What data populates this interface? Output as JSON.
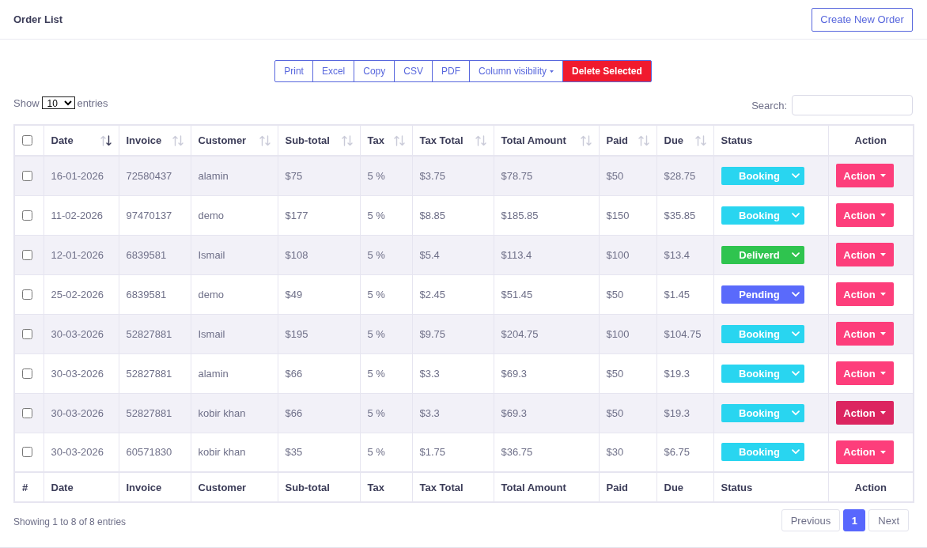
{
  "header": {
    "title": "Order List",
    "create_button": "Create New Order"
  },
  "toolbar": [
    {
      "label": "Print",
      "kind": "plain"
    },
    {
      "label": "Excel",
      "kind": "plain"
    },
    {
      "label": "Copy",
      "kind": "plain"
    },
    {
      "label": "CSV",
      "kind": "plain"
    },
    {
      "label": "PDF",
      "kind": "plain"
    },
    {
      "label": "Column visibility",
      "kind": "dropdown"
    },
    {
      "label": "Delete Selected",
      "kind": "danger"
    }
  ],
  "length_menu": {
    "label_before": "Show",
    "value": "10",
    "label_after": "entries"
  },
  "search": {
    "label": "Search:"
  },
  "table": {
    "select_all_checked": false,
    "columns": [
      {
        "label": "Date",
        "sortable": true,
        "sorted": true
      },
      {
        "label": "Invoice",
        "sortable": true,
        "sorted": false
      },
      {
        "label": "Customer",
        "sortable": true,
        "sorted": false
      },
      {
        "label": "Sub-total",
        "sortable": true,
        "sorted": false
      },
      {
        "label": "Tax",
        "sortable": true,
        "sorted": false
      },
      {
        "label": "Tax Total",
        "sortable": true,
        "sorted": false
      },
      {
        "label": "Total Amount",
        "sortable": true,
        "sorted": false
      },
      {
        "label": "Paid",
        "sortable": true,
        "sorted": false
      },
      {
        "label": "Due",
        "sortable": true,
        "sorted": false
      },
      {
        "label": "Status",
        "sortable": false
      },
      {
        "label": "Action",
        "sortable": false
      }
    ],
    "rows": [
      {
        "checked": false,
        "cells": [
          "16-01-2026",
          "72580437",
          "alamin",
          "$75",
          "5 %",
          "$3.75",
          "$78.75",
          "$50",
          "$28.75"
        ],
        "status": {
          "label": "Booking",
          "color": "#29d5f0"
        },
        "action": {
          "label": "Action",
          "hovered": false
        }
      },
      {
        "checked": false,
        "cells": [
          "11-02-2026",
          "97470137",
          "demo",
          "$177",
          "5 %",
          "$8.85",
          "$185.85",
          "$150",
          "$35.85"
        ],
        "status": {
          "label": "Booking",
          "color": "#29d5f0"
        },
        "action": {
          "label": "Action",
          "hovered": false
        }
      },
      {
        "checked": false,
        "cells": [
          "12-01-2026",
          "6839581",
          "Ismail",
          "$108",
          "5 %",
          "$5.4",
          "$113.4",
          "$100",
          "$13.4"
        ],
        "status": {
          "label": "Deliverd",
          "color": "#2fc44f"
        },
        "action": {
          "label": "Action",
          "hovered": false
        }
      },
      {
        "checked": false,
        "cells": [
          "25-02-2026",
          "6839581",
          "demo",
          "$49",
          "5 %",
          "$2.45",
          "$51.45",
          "$50",
          "$1.45"
        ],
        "status": {
          "label": "Pending",
          "color": "#5a6afb"
        },
        "action": {
          "label": "Action",
          "hovered": false
        }
      },
      {
        "checked": false,
        "cells": [
          "30-03-2026",
          "52827881",
          "Ismail",
          "$195",
          "5 %",
          "$9.75",
          "$204.75",
          "$100",
          "$104.75"
        ],
        "status": {
          "label": "Booking",
          "color": "#29d5f0"
        },
        "action": {
          "label": "Action",
          "hovered": false
        }
      },
      {
        "checked": false,
        "cells": [
          "30-03-2026",
          "52827881",
          "alamin",
          "$66",
          "5 %",
          "$3.3",
          "$69.3",
          "$50",
          "$19.3"
        ],
        "status": {
          "label": "Booking",
          "color": "#29d5f0"
        },
        "action": {
          "label": "Action",
          "hovered": false
        }
      },
      {
        "checked": false,
        "cells": [
          "30-03-2026",
          "52827881",
          "kobir khan",
          "$66",
          "5 %",
          "$3.3",
          "$69.3",
          "$50",
          "$19.3"
        ],
        "status": {
          "label": "Booking",
          "color": "#29d5f0"
        },
        "action": {
          "label": "Action",
          "hovered": true
        }
      },
      {
        "checked": false,
        "cells": [
          "30-03-2026",
          "60571830",
          "kobir khan",
          "$35",
          "5 %",
          "$1.75",
          "$36.75",
          "$30",
          "$6.75"
        ],
        "status": {
          "label": "Booking",
          "color": "#29d5f0"
        },
        "action": {
          "label": "Action",
          "hovered": false
        }
      }
    ],
    "footer": [
      "#",
      "Date",
      "Invoice",
      "Customer",
      "Sub-total",
      "Tax",
      "Tax Total",
      "Total Amount",
      "Paid",
      "Due",
      "Status",
      "Action"
    ]
  },
  "info": "Showing 1 to 8 of 8 entries",
  "pagination": [
    {
      "label": "Previous",
      "kind": "previous",
      "selected": false
    },
    {
      "label": "1",
      "kind": "page",
      "selected": true
    },
    {
      "label": "Next",
      "kind": "next",
      "selected": false
    }
  ]
}
